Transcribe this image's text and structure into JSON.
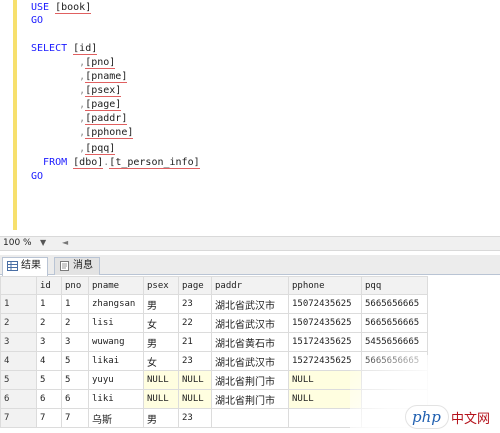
{
  "editor": {
    "lines": [
      {
        "tokens": [
          {
            "t": "kw",
            "v": "USE "
          },
          {
            "t": "ident",
            "v": "[book]"
          }
        ]
      },
      {
        "tokens": [
          {
            "t": "kw",
            "v": "GO"
          }
        ]
      },
      {
        "tokens": []
      },
      {
        "tokens": [
          {
            "t": "kw",
            "v": "SELECT "
          },
          {
            "t": "ident",
            "v": "[id]"
          }
        ]
      },
      {
        "tokens": [
          {
            "t": "pad",
            "v": "        "
          },
          {
            "t": "op",
            "v": ","
          },
          {
            "t": "ident",
            "v": "[pno]"
          }
        ]
      },
      {
        "tokens": [
          {
            "t": "pad",
            "v": "        "
          },
          {
            "t": "op",
            "v": ","
          },
          {
            "t": "ident",
            "v": "[pname]"
          }
        ]
      },
      {
        "tokens": [
          {
            "t": "pad",
            "v": "        "
          },
          {
            "t": "op",
            "v": ","
          },
          {
            "t": "ident",
            "v": "[psex]"
          }
        ]
      },
      {
        "tokens": [
          {
            "t": "pad",
            "v": "        "
          },
          {
            "t": "op",
            "v": ","
          },
          {
            "t": "ident",
            "v": "[page]"
          }
        ]
      },
      {
        "tokens": [
          {
            "t": "pad",
            "v": "        "
          },
          {
            "t": "op",
            "v": ","
          },
          {
            "t": "ident",
            "v": "[paddr]"
          }
        ]
      },
      {
        "tokens": [
          {
            "t": "pad",
            "v": "        "
          },
          {
            "t": "op",
            "v": ","
          },
          {
            "t": "ident",
            "v": "[pphone]"
          }
        ]
      },
      {
        "tokens": [
          {
            "t": "pad",
            "v": "        "
          },
          {
            "t": "op",
            "v": ","
          },
          {
            "t": "ident",
            "v": "[pqq]"
          }
        ]
      },
      {
        "tokens": [
          {
            "t": "pad",
            "v": "  "
          },
          {
            "t": "kw",
            "v": "FROM "
          },
          {
            "t": "ident",
            "v": "[dbo]"
          },
          {
            "t": "op",
            "v": "."
          },
          {
            "t": "ident",
            "v": "[t_person_info]"
          }
        ]
      },
      {
        "tokens": [
          {
            "t": "kw",
            "v": "GO"
          }
        ]
      }
    ]
  },
  "zoom": {
    "value": "100 %"
  },
  "tabs": [
    {
      "label": "结果",
      "active": true,
      "icon": "grid-icon"
    },
    {
      "label": "消息",
      "active": false,
      "icon": "message-icon"
    }
  ],
  "grid": {
    "columns": [
      "id",
      "pno",
      "pname",
      "psex",
      "page",
      "paddr",
      "pphone",
      "pqq"
    ],
    "rows": [
      [
        "1",
        "1",
        "1",
        "zhangsan",
        "男",
        "23",
        "湖北省武汉市",
        "15072435625",
        "5665656665"
      ],
      [
        "2",
        "2",
        "2",
        "lisi",
        "女",
        "22",
        "湖北省武汉市",
        "15072435625",
        "5665656665"
      ],
      [
        "3",
        "3",
        "3",
        "wuwang",
        "男",
        "21",
        "湖北省黄石市",
        "15172435625",
        "5455656665"
      ],
      [
        "4",
        "4",
        "5",
        "likai",
        "女",
        "23",
        "湖北省武汉市",
        "15272435625",
        "5665656665"
      ],
      [
        "5",
        "5",
        "5",
        "yuyu",
        "NULL",
        "NULL",
        "湖北省荆门市",
        "NULL",
        ""
      ],
      [
        "6",
        "6",
        "6",
        "liki",
        "NULL",
        "NULL",
        "湖北省荆门市",
        "NULL",
        ""
      ],
      [
        "7",
        "7",
        "7",
        "乌斯",
        "男",
        "23",
        "",
        "",
        ""
      ]
    ]
  },
  "watermark": {
    "brand": "php",
    "site": "中文网"
  },
  "colors": {
    "keyword": "#1a1aff",
    "squiggle": "#e06060",
    "change_bar": "#f7e06d",
    "null_cell": "#fffee0"
  }
}
